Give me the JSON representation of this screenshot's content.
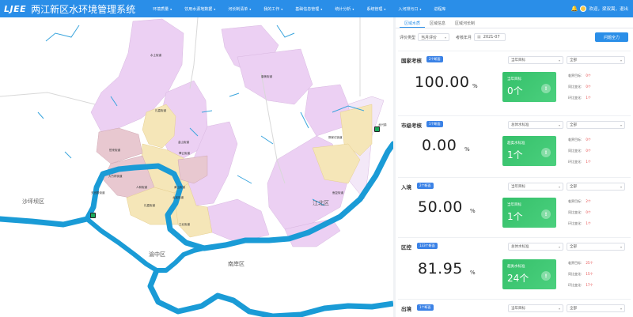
{
  "header": {
    "logo": "LJEE",
    "title": "两江新区水环境管理系统",
    "nav": [
      "环境质量",
      "饮用水源地数据",
      "河长制清单",
      "我的工作",
      "基础信息管理",
      "统计分析",
      "系统管理",
      "入河排污口",
      "进程库"
    ],
    "user_text": "欢迎，梁双嵩，退出"
  },
  "map": {
    "labels": {
      "shapingba": "沙坪坝区",
      "yuzhong": "渝中区",
      "nanan": "南岸区",
      "jiangbei": "江北区",
      "shuitu": "水土街道",
      "jiangxi": "礼嘉街道",
      "lijia": "礼嘉街道",
      "kangmei": "康美街道",
      "yuelai": "悦来街道",
      "guojiatuo": "郭家沱街道",
      "fuxing": "复兴街道",
      "dazhulin": "大竹林街道",
      "renhe": "人和街道",
      "tianqi": "天宫殿街道",
      "jinshan": "金山街道",
      "cuiyun": "翠云街道",
      "dazhulin2": "大竹林街道",
      "huangshan": "黄山街道",
      "longxi": "龙溪街道",
      "jiangbei2": "江北街道",
      "yufu": "鱼复街道",
      "longxing": "龙兴镇",
      "shiping": "石坪街道",
      "xixin": "溪新街道"
    }
  },
  "panel": {
    "tabs": [
      "区域水质",
      "区域信息",
      "区域河长制"
    ],
    "filter_type_label": "评价类型",
    "filter_type_value": "当月评价",
    "filter_month_label": "考核年月",
    "filter_month_value": "2021-07",
    "query_button": "问题全力",
    "cards": [
      {
        "title": "国家考核",
        "badge": "2个断面",
        "select1": "当年目标",
        "select2": "全部",
        "value": "100.00",
        "unit": "%",
        "box_label": "当年目标",
        "box_count": "0个",
        "m1_label": "临界目标:",
        "m1_value": "0个",
        "m2_label": "同比变化:",
        "m2_value": "0个",
        "m3_label": "环比变化:",
        "m3_value": "1个"
      },
      {
        "title": "市级考核",
        "badge": "1个断面",
        "select1": "总体水标准",
        "select2": "全部",
        "value": "0.00",
        "unit": "%",
        "box_label": "超类水标准",
        "box_count": "1个",
        "m1_label": "临界目标:",
        "m1_value": "0个",
        "m2_label": "同比变化:",
        "m2_value": "0个",
        "m3_label": "环比变化:",
        "m3_value": "1个"
      },
      {
        "title": "入境",
        "badge": "2个断面",
        "select1": "当年目标",
        "select2": "全部",
        "value": "50.00",
        "unit": "%",
        "box_label": "当年目标",
        "box_count": "1个",
        "m1_label": "临界目标:",
        "m1_value": "2个",
        "m2_label": "同比变化:",
        "m2_value": "0个",
        "m3_label": "环比变化:",
        "m3_value": "1个"
      },
      {
        "title": "区控",
        "badge": "133个断面",
        "select1": "总体水标准",
        "select2": "全部",
        "value": "81.95",
        "unit": "%",
        "box_label": "超类水标准",
        "box_count": "24个",
        "m1_label": "临界目标:",
        "m1_value": "25个",
        "m2_label": "同比变化:",
        "m2_value": "15个",
        "m3_label": "环比变化:",
        "m3_value": "17个"
      },
      {
        "title": "出境",
        "badge": "1个断面",
        "select1": "当年目标",
        "select2": "全部"
      }
    ]
  }
}
